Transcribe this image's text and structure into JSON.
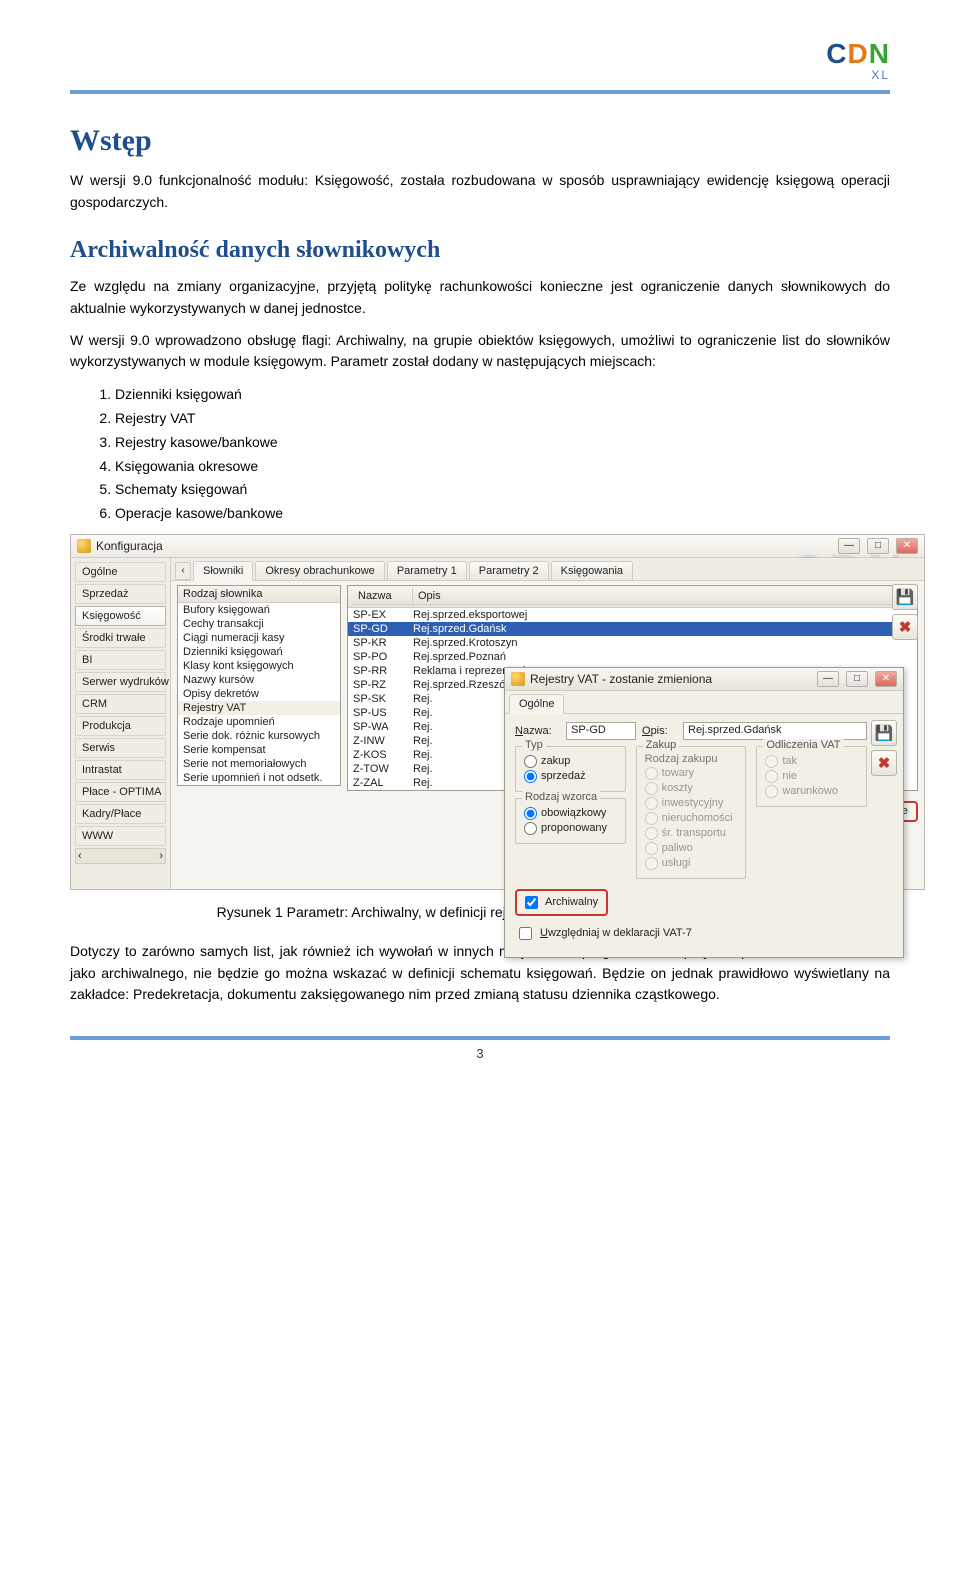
{
  "logo": {
    "c": "C",
    "d": "D",
    "n": "N",
    "sub": "XL"
  },
  "h1": "Wstęp",
  "p1": "W wersji 9.0 funkcjonalność modułu:  Księgowość, została rozbudowana w sposób usprawniający ewidencję księgową operacji gospodarczych.",
  "h2": "Archiwalność danych słownikowych",
  "p2": "Ze względu na zmiany organizacyjne, przyjętą politykę rachunkowości konieczne jest ograniczenie danych słownikowych do aktualnie wykorzystywanych  w danej jednostce.",
  "p3": "W wersji 9.0 wprowadzono obsługę flagi: Archiwalny, na grupie obiektów księgowych, umożliwi to ograniczenie list do słowników wykorzystywanych w module księgowym. Parametr został dodany w następujących miejscach:",
  "list": [
    "Dzienniki księgowań",
    "Rejestry VAT",
    "Rejestry kasowe/bankowe",
    "Księgowania okresowe",
    "Schematy księgowań",
    "Operacje kasowe/bankowe"
  ],
  "caption": "Rysunek 1 Parametr: Archiwalny, w definicji rejestru VAT oraz na liście rejestrów VAT.",
  "p4": "Dotyczy to zarówno samych list, jak również ich wywołań w innych miejscach w programie – na przykład po określeniu dziennika jako archiwalnego, nie będzie go można wskazać w definicji schematu księgowań. Będzie on jednak prawidłowo wyświetlany na zakładce: Predekretacja, dokumentu zaksięgowanego nim przed zmianą statusu dziennika cząstkowego.",
  "pagenum": "3",
  "config_window": {
    "title": "Konfiguracja",
    "watermark": "CDN",
    "sidebar": [
      "Ogólne",
      "Sprzedaż",
      "Księgowość",
      "Środki trwałe",
      "BI",
      "Serwer wydruków",
      "CRM",
      "Produkcja",
      "Serwis",
      "Intrastat",
      "Płace - OPTIMA",
      "Kadry/Płace",
      "WWW"
    ],
    "sidebar_active_index": 2,
    "tabs": [
      "Słowniki",
      "Okresy obrachunkowe",
      "Parametry 1",
      "Parametry 2",
      "Księgowania"
    ],
    "tab_active_index": 0,
    "col1_header": "Rodzaj słownika",
    "col1_rows": [
      "Bufory księgowań",
      "Cechy transakcji",
      "Ciągi numeracji kasy",
      "Dzienniki księgowań",
      "Klasy kont księgowych",
      "Nazwy kursów",
      "Opisy dekretów",
      "Rejestry VAT",
      "Rodzaje upomnień",
      "Serie dok. różnic kursowych",
      "Serie kompensat",
      "Serie not memoriałowych",
      "Serie upomnień i not odsetk."
    ],
    "col1_selected_index": 7,
    "col2_headers": {
      "nazwa": "Nazwa",
      "opis": "Opis"
    },
    "col2_rows": [
      {
        "n": "SP-EX",
        "o": "Rej.sprzed.eksportowej"
      },
      {
        "n": "SP-GD",
        "o": "Rej.sprzed.Gdańsk"
      },
      {
        "n": "SP-KR",
        "o": "Rej.sprzed.Krotoszyn"
      },
      {
        "n": "SP-PO",
        "o": "Rej.sprzed.Poznań"
      },
      {
        "n": "SP-RR",
        "o": "Reklama i reprezentacja"
      },
      {
        "n": "SP-RZ",
        "o": "Rej.sprzed.Rzeszów"
      },
      {
        "n": "SP-SK",
        "o": "Rej."
      },
      {
        "n": "SP-US",
        "o": "Rej."
      },
      {
        "n": "SP-WA",
        "o": "Rej."
      },
      {
        "n": "Z-INW",
        "o": "Rej."
      },
      {
        "n": "Z-KOS",
        "o": "Rej."
      },
      {
        "n": "Z-TOW",
        "o": "Rej."
      },
      {
        "n": "Z-ZAL",
        "o": "Rej."
      }
    ],
    "col2_selected_index": 1,
    "archive_label": "Archiwalne"
  },
  "dialog": {
    "title": "Rejestry VAT - zostanie zmieniona",
    "tab": "Ogólne",
    "nazwa_label_u": "N",
    "nazwa_label_rest": "azwa:",
    "nazwa_value": "SP-GD",
    "opis_label_u": "O",
    "opis_label_rest": "pis:",
    "opis_value": "Rej.sprzed.Gdańsk",
    "grp_typ": "Typ",
    "typ_zakup": "zakup",
    "typ_sprzedaz": "sprzedaż",
    "grp_rodzaj": "Rodzaj wzorca",
    "rodz_obow": "obowiązkowy",
    "rodz_prop": "proponowany",
    "grp_zakup": "Zakup",
    "zakup_sub": "Rodzaj zakupu",
    "zakup_opts": [
      "towary",
      "koszty",
      "inwestycyjny",
      "nieruchomości",
      "śr. transportu",
      "paliwo",
      "usługi"
    ],
    "grp_odlicz": "Odliczenia VAT",
    "odlicz_opts": [
      "tak",
      "nie",
      "warunkowo"
    ],
    "arch_label": "Archiwalny",
    "vat7_u": "U",
    "vat7_rest": "względniaj w deklaracji VAT-7"
  }
}
